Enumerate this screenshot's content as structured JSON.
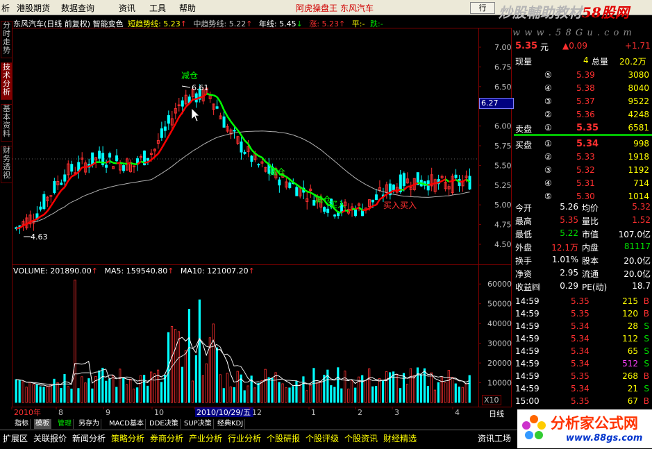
{
  "menu": {
    "items": [
      "析",
      "港股期货",
      "数据查询",
      "资讯",
      "工具",
      "帮助"
    ],
    "center_title_left": "阿虎操盘王",
    "center_title_right": "东风汽车",
    "right_btn": "行",
    "watermark_text": "炒股輔助教材",
    "watermark_red": "58股网",
    "watermark_url": "w w w . 5 8 G u . c o m"
  },
  "left_tabs": [
    "分时走势",
    "技术分析",
    "基本资料",
    "财务透视"
  ],
  "chart_header": {
    "title": "东风汽车(日线 前复权) 智能变色",
    "short_label": "短趋势线",
    "short_value": "5.23",
    "mid_label": "中趋势线",
    "mid_value": "5.22",
    "year_label": "年线",
    "year_value": "5.45",
    "up_label": "涨",
    "up_value": "5.23",
    "flat_label": "平",
    "flat_value": "-",
    "down_label": "跌",
    "down_value": "-"
  },
  "price_axis": [
    "7.00",
    "6.75",
    "6.50",
    "6.25",
    "6.00",
    "5.75",
    "5.50",
    "5.25",
    "5.00",
    "4.75",
    "4.50"
  ],
  "price_cursor": "6.27",
  "price_annotations": {
    "high_label": "6.61",
    "low_label": "4.63",
    "signals": [
      "减仓",
      "减仓",
      "减仓",
      "买入",
      "买入"
    ]
  },
  "volume_header": {
    "vol_label": "VOLUME",
    "vol_value": "201890.00",
    "ma5_label": "MA5",
    "ma5_value": "159540.80",
    "ma10_label": "MA10",
    "ma10_value": "121007.20"
  },
  "volume_axis": [
    "60000",
    "50000",
    "40000",
    "30000",
    "20000",
    "10000"
  ],
  "volume_unit": "X10",
  "date_axis": [
    "2010年",
    "8",
    "9",
    "10",
    "2010/10/29/五",
    "12",
    "1",
    "2",
    "3",
    "4"
  ],
  "period_label": "日线",
  "quote": {
    "price": "5.35",
    "price_unit": "元",
    "change": "▲0.09",
    "change_pct": "+1.71",
    "now_vol_label": "现量",
    "now_vol": "4",
    "total_vol_label": "总量",
    "total_vol": "20.2万",
    "asks": [
      {
        "level": "⑤",
        "price": "5.39",
        "vol": "3080"
      },
      {
        "level": "④",
        "price": "5.38",
        "vol": "8040"
      },
      {
        "level": "③",
        "price": "5.37",
        "vol": "9522"
      },
      {
        "level": "②",
        "price": "5.36",
        "vol": "4248"
      },
      {
        "level": "①",
        "price": "5.35",
        "vol": "6581"
      }
    ],
    "ask_label": "卖盘",
    "bid_label": "买盘",
    "bids": [
      {
        "level": "①",
        "price": "5.34",
        "vol": "998"
      },
      {
        "level": "②",
        "price": "5.33",
        "vol": "1918"
      },
      {
        "level": "③",
        "price": "5.32",
        "vol": "1192"
      },
      {
        "level": "④",
        "price": "5.31",
        "vol": "714"
      },
      {
        "level": "⑤",
        "price": "5.30",
        "vol": "1014"
      }
    ],
    "stats": [
      {
        "l1": "今开",
        "v1": "5.26",
        "c1": "c-white",
        "l2": "均价",
        "v2": "5.32",
        "c2": "c-red"
      },
      {
        "l1": "最高",
        "v1": "5.35",
        "c1": "c-red",
        "l2": "量比",
        "v2": "1.52",
        "c2": "c-red"
      },
      {
        "l1": "最低",
        "v1": "5.22",
        "c1": "c-green",
        "l2": "市值",
        "v2": "107.0亿",
        "c2": "c-white"
      },
      {
        "l1": "外盘",
        "v1": "12.1万",
        "c1": "c-red",
        "l2": "内盘",
        "v2": "81117",
        "c2": "c-green"
      },
      {
        "l1": "换手",
        "v1": "1.01%",
        "c1": "c-white",
        "l2": "股本",
        "v2": "20.0亿",
        "c2": "c-white"
      },
      {
        "l1": "净资",
        "v1": "2.95",
        "c1": "c-white",
        "l2": "流通",
        "v2": "20.0亿",
        "c2": "c-white"
      },
      {
        "l1": "收益㈣",
        "v1": "0.29",
        "c1": "c-white",
        "l2": "PE(动)",
        "v2": "18.7",
        "c2": "c-white"
      }
    ],
    "ticks": [
      {
        "time": "14:59",
        "price": "5.35",
        "pc": "c-red",
        "vol": "215",
        "vc": "c-yellow",
        "side": "B",
        "sc": "c-red"
      },
      {
        "time": "14:59",
        "price": "5.35",
        "pc": "c-red",
        "vol": "120",
        "vc": "c-yellow",
        "side": "B",
        "sc": "c-red"
      },
      {
        "time": "14:59",
        "price": "5.34",
        "pc": "c-red",
        "vol": "28",
        "vc": "c-yellow",
        "side": "S",
        "sc": "c-green"
      },
      {
        "time": "14:59",
        "price": "5.34",
        "pc": "c-red",
        "vol": "112",
        "vc": "c-yellow",
        "side": "S",
        "sc": "c-green"
      },
      {
        "time": "14:59",
        "price": "5.34",
        "pc": "c-red",
        "vol": "65",
        "vc": "c-yellow",
        "side": "S",
        "sc": "c-green"
      },
      {
        "time": "14:59",
        "price": "5.34",
        "pc": "c-red",
        "vol": "512",
        "vc": "c-mag",
        "side": "S",
        "sc": "c-green"
      },
      {
        "time": "14:59",
        "price": "5.35",
        "pc": "c-red",
        "vol": "268",
        "vc": "c-yellow",
        "side": "B",
        "sc": "c-red"
      },
      {
        "time": "14:59",
        "price": "5.34",
        "pc": "c-red",
        "vol": "21",
        "vc": "c-yellow",
        "side": "S",
        "sc": "c-green"
      },
      {
        "time": "15:00",
        "price": "5.35",
        "pc": "c-red",
        "vol": "67",
        "vc": "c-yellow",
        "side": "B",
        "sc": "c-red"
      }
    ]
  },
  "bottom_tabs": [
    "指标",
    "模板",
    "管理",
    "另存为",
    "MACD基本",
    "DDE决策",
    "SUP决策",
    "经典KDJ"
  ],
  "status_items": [
    "扩展区",
    "关联报价",
    "新闻分析",
    "策略分析",
    "券商分析",
    "产业分析",
    "行业分析",
    "个股研报",
    "个股评级",
    "个股资讯",
    "财经精选",
    "资讯工场"
  ],
  "logo": {
    "name": "分析家公式网",
    "url": "www.88gs.com"
  },
  "colors": {
    "up": "#ff3030",
    "down": "#00e000",
    "ma_short_up": "#ff0000",
    "ma_short_down": "#00ff00",
    "year_line": "#c0c0c0",
    "grid": "#800000"
  }
}
